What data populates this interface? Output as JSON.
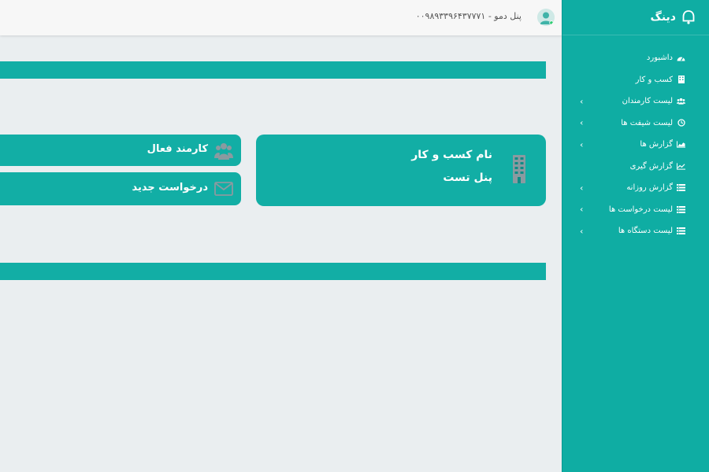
{
  "brand": {
    "name": "دینگ"
  },
  "header": {
    "user_text": "پنل دمو - ۰۰۹۸۹۳۳۹۶۴۳۷۷۷۱",
    "avatar_icon": "user-avatar-icon"
  },
  "sidebar": {
    "items": [
      {
        "label": "داشبورد",
        "icon": "dashboard-icon",
        "has_submenu": false
      },
      {
        "label": "کسب و کار",
        "icon": "building-icon",
        "has_submenu": false
      },
      {
        "label": "لیست کارمندان",
        "icon": "users-icon",
        "has_submenu": true
      },
      {
        "label": "لیست شیفت ها",
        "icon": "clock-icon",
        "has_submenu": true
      },
      {
        "label": "گزارش ها",
        "icon": "chart-icon",
        "has_submenu": true
      },
      {
        "label": "گزارش گیری",
        "icon": "line-chart-icon",
        "has_submenu": false
      },
      {
        "label": "گزارش روزانه",
        "icon": "list-icon",
        "has_submenu": true
      },
      {
        "label": "لیست درخواست ها",
        "icon": "list-icon",
        "has_submenu": true
      },
      {
        "label": "لیست دستگاه ها",
        "icon": "list-icon",
        "has_submenu": true
      }
    ]
  },
  "main": {
    "business_card": {
      "title": "نام کسب و کار",
      "value": "پنل تست",
      "icon": "building-icon"
    },
    "active_employee": {
      "label": "کارمند فعال",
      "icon": "users-icon"
    },
    "new_request": {
      "label": "درخواست جدید",
      "icon": "envelope-icon"
    }
  },
  "colors": {
    "accent": "#12aea5",
    "sidebar": "#0fada3",
    "background": "#eaeef0"
  }
}
